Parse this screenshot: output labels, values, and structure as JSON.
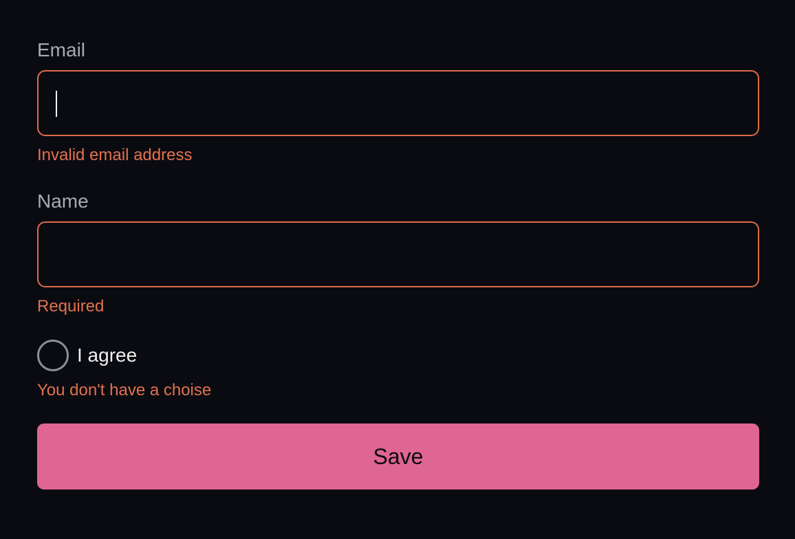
{
  "form": {
    "email": {
      "label": "Email",
      "value": "",
      "error": "Invalid email address"
    },
    "name": {
      "label": "Name",
      "value": "",
      "error": "Required"
    },
    "agree": {
      "label": "I agree",
      "checked": false,
      "error": "You don't have a choise"
    },
    "save_label": "Save"
  },
  "colors": {
    "background": "#0a0b10",
    "error": "#e3714f",
    "input_border_error": "#e06b4a",
    "button": "#de6690",
    "label": "#a8aab4"
  }
}
